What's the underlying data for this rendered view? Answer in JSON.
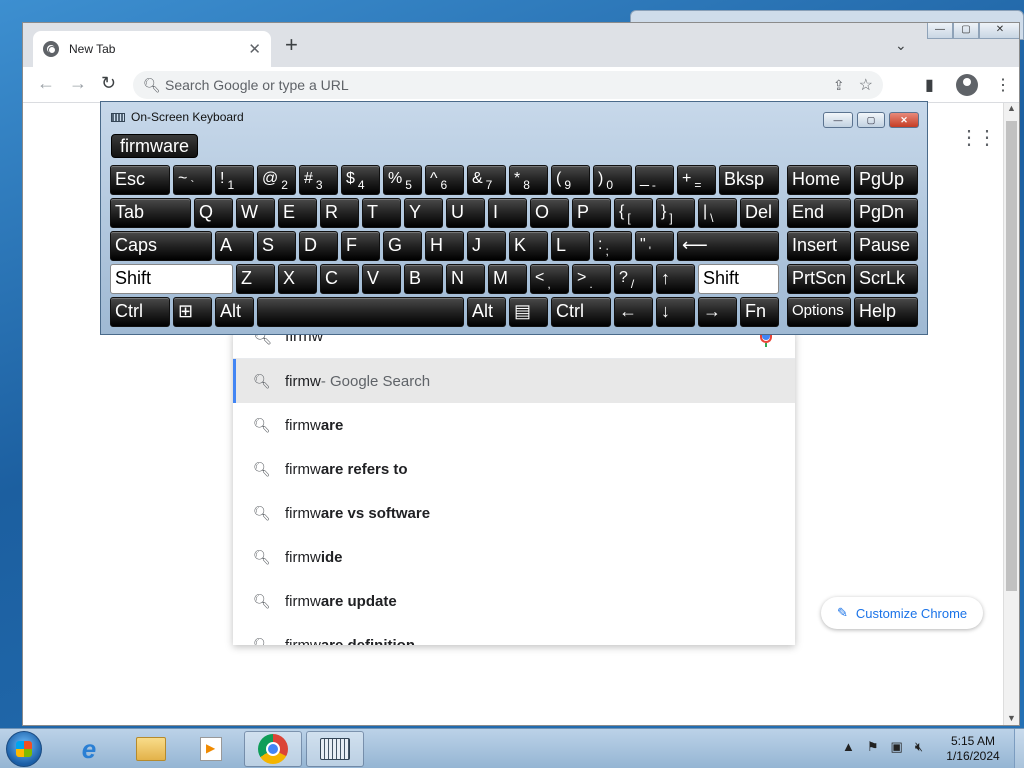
{
  "browser": {
    "tab_title": "New Tab",
    "new_tab_symbol": "+",
    "tab_search_symbol": "⌄",
    "omnibox_placeholder": "Search Google or type a URL",
    "window_controls": [
      "—",
      "▢",
      "✕"
    ]
  },
  "search": {
    "query": "firmw",
    "suggestions": [
      {
        "typed": "firmw",
        "rest": "",
        "hint": " - Google Search"
      },
      {
        "typed": "firmw",
        "rest": "are",
        "hint": ""
      },
      {
        "typed": "firmw",
        "rest": "are refers to",
        "hint": ""
      },
      {
        "typed": "firmw",
        "rest": "are vs software",
        "hint": ""
      },
      {
        "typed": "firmw",
        "rest": "ide",
        "hint": ""
      },
      {
        "typed": "firmw",
        "rest": "are update",
        "hint": ""
      },
      {
        "typed": "firmw",
        "rest": "are definition",
        "hint": ""
      }
    ]
  },
  "customize_label": "Customize Chrome",
  "osk": {
    "title": "On-Screen Keyboard",
    "prediction": "firmware",
    "keys": {
      "esc": "Esc",
      "bksp": "Bksp",
      "home": "Home",
      "pgup": "PgUp",
      "tab": "Tab",
      "del": "Del",
      "end": "End",
      "pgdn": "PgDn",
      "caps": "Caps",
      "insert": "Insert",
      "pause": "Pause",
      "shift_l": "Shift",
      "shift_r": "Shift",
      "prtscn": "PrtScn",
      "scrlk": "ScrLk",
      "ctrl_l": "Ctrl",
      "alt_l": "Alt",
      "alt_r": "Alt",
      "ctrl_r": "Ctrl",
      "fn": "Fn",
      "options": "Options",
      "help": "Help",
      "row1": [
        [
          "~",
          "`"
        ],
        [
          "!",
          "1"
        ],
        [
          "@",
          "2"
        ],
        [
          "#",
          "3"
        ],
        [
          "$",
          "4"
        ],
        [
          "%",
          "5"
        ],
        [
          "^",
          "6"
        ],
        [
          "&",
          "7"
        ],
        [
          "*",
          "8"
        ],
        [
          "(",
          "9"
        ],
        [
          ")",
          "0"
        ],
        [
          "_",
          "-"
        ],
        [
          "+",
          "="
        ]
      ],
      "row2": [
        "Q",
        "W",
        "E",
        "R",
        "T",
        "Y",
        "U",
        "I",
        "O",
        "P",
        [
          "{",
          "["
        ],
        [
          "}",
          "]"
        ],
        [
          "|",
          "\\"
        ]
      ],
      "row3": [
        "A",
        "S",
        "D",
        "F",
        "G",
        "H",
        "J",
        "K",
        "L",
        [
          ":",
          ";"
        ],
        [
          "\"",
          "'"
        ]
      ],
      "row4": [
        "Z",
        "X",
        "C",
        "V",
        "B",
        "N",
        "M",
        [
          "<",
          ","
        ],
        [
          ">",
          "."
        ],
        [
          "?",
          "/"
        ]
      ],
      "arrows": [
        "↑",
        "←",
        "↓",
        "→"
      ]
    }
  },
  "taskbar": {
    "time": "5:15 AM",
    "date": "1/16/2024"
  }
}
